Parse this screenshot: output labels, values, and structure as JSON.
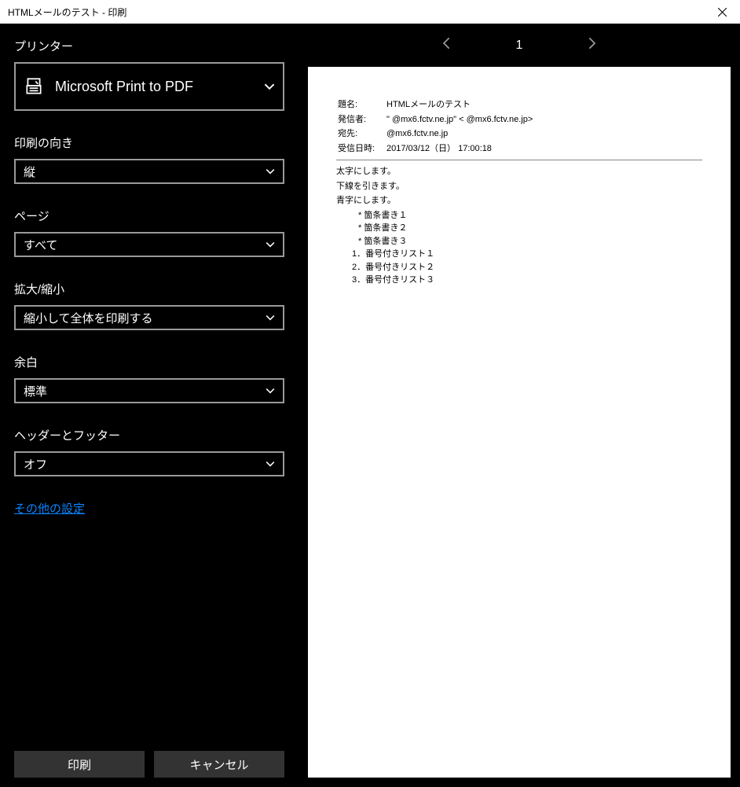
{
  "titlebar": {
    "title": "HTMLメールのテスト - 印刷"
  },
  "printer": {
    "label": "プリンター",
    "value": "Microsoft Print to PDF"
  },
  "orientation": {
    "label": "印刷の向き",
    "value": "縦"
  },
  "pages": {
    "label": "ページ",
    "value": "すべて"
  },
  "scale": {
    "label": "拡大/縮小",
    "value": "縮小して全体を印刷する"
  },
  "margins": {
    "label": "余白",
    "value": "標準"
  },
  "headerFooter": {
    "label": "ヘッダーとフッター",
    "value": "オフ"
  },
  "moreSettings": "その他の設定",
  "buttons": {
    "print": "印刷",
    "cancel": "キャンセル"
  },
  "pageNumber": "1",
  "preview": {
    "subjectLabel": "題名:",
    "subject": "HTMLメールのテスト",
    "fromLabel": "発信者:",
    "fromLine": "\"        @mx6.fctv.ne.jp\" <       @mx6.fctv.ne.jp>",
    "toLabel": "宛先:",
    "toLine": "        @mx6.fctv.ne.jp",
    "dateLabel": "受信日時:",
    "date": "2017/03/12（日） 17:00:18",
    "body1": "太字にします。",
    "body2": "下線を引きます。",
    "body3": "青字にします。",
    "bullets": [
      "箇条書き１",
      "箇条書き２",
      "箇条書き３"
    ],
    "ordered": [
      "番号付きリスト１",
      "番号付きリスト２",
      "番号付きリスト３"
    ]
  }
}
